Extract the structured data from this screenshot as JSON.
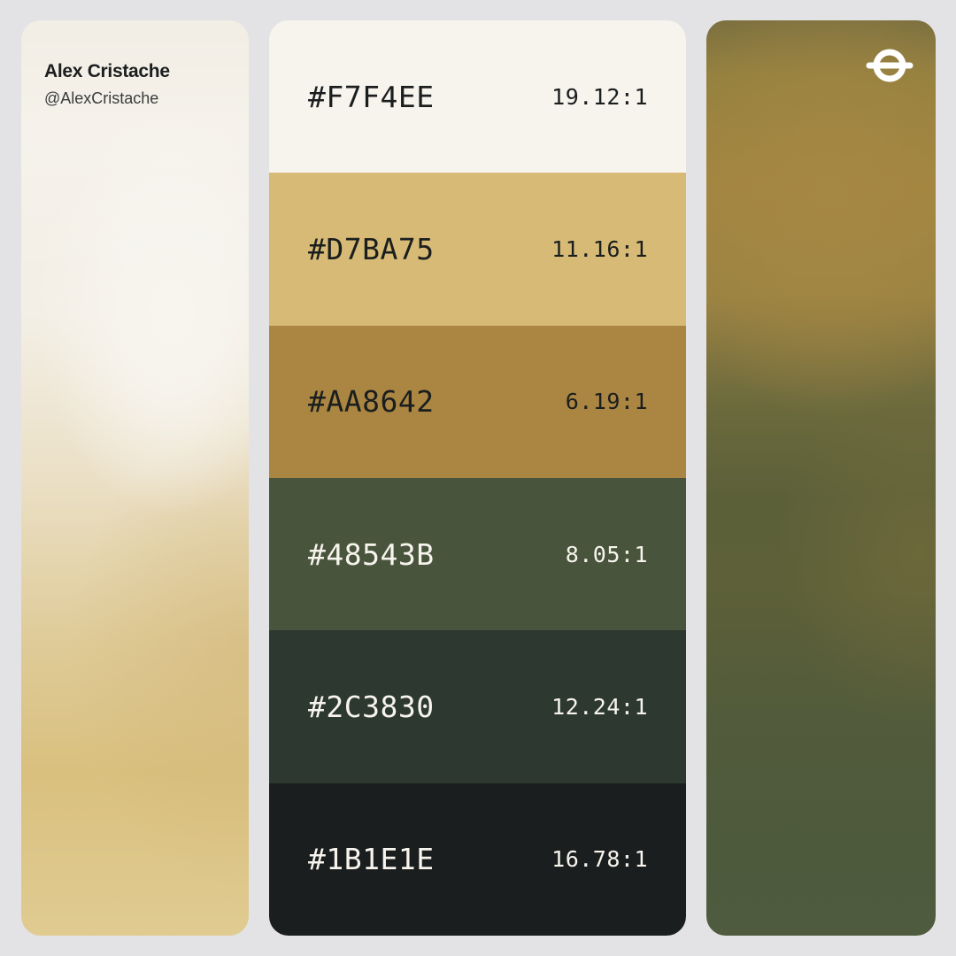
{
  "author": {
    "name": "Alex Cristache",
    "handle": "@AlexCristache"
  },
  "logo": {
    "icon": "brand-logo-icon",
    "color": "#ffffff"
  },
  "palette": [
    {
      "hex": "#F7F4EE",
      "ratio": "19.12:1",
      "bg": "#f7f4ee",
      "text_color": "#1b1e1e"
    },
    {
      "hex": "#D7BA75",
      "ratio": "11.16:1",
      "bg": "#d7ba75",
      "text_color": "#1b1e1e"
    },
    {
      "hex": "#AA8642",
      "ratio": "6.19:1",
      "bg": "#aa8642",
      "text_color": "#1b1e1e"
    },
    {
      "hex": "#48543B",
      "ratio": "8.05:1",
      "bg": "#48543b",
      "text_color": "#f7f4ee"
    },
    {
      "hex": "#2C3830",
      "ratio": "12.24:1",
      "bg": "#2c3830",
      "text_color": "#f7f4ee"
    },
    {
      "hex": "#1B1E1E",
      "ratio": "16.78:1",
      "bg": "#1b1e1e",
      "text_color": "#f7f4ee"
    }
  ],
  "colors": {
    "page_background": "#e3e3e5"
  }
}
